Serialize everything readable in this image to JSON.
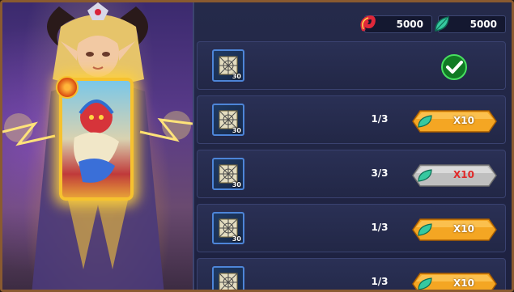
{
  "colors": {
    "row_bg": "#2a3055",
    "item_border": "#4d85d8",
    "button_gold": "#f4a623",
    "button_gray": "#bfbfbf",
    "disabled_text": "#e02a2a",
    "check_green": "#25c13c"
  },
  "hero": {
    "card_icon": "fire-element-icon"
  },
  "currency": [
    {
      "icon": "red-swirl-currency-icon",
      "value": "5000"
    },
    {
      "icon": "green-leaf-gem-icon",
      "value": "5000"
    }
  ],
  "rows": [
    {
      "item_icon": "web-scroll-icon",
      "qty": "30",
      "progress": "",
      "button_label": "",
      "status": "claimed"
    },
    {
      "item_icon": "web-scroll-icon",
      "qty": "30",
      "progress": "1/3",
      "button_label": "X10",
      "status": "available"
    },
    {
      "item_icon": "web-scroll-icon",
      "qty": "30",
      "progress": "3/3",
      "button_label": "X10",
      "status": "maxed"
    },
    {
      "item_icon": "web-scroll-icon",
      "qty": "30",
      "progress": "1/3",
      "button_label": "X10",
      "status": "available"
    },
    {
      "item_icon": "web-scroll-icon",
      "qty": "30",
      "progress": "1/3",
      "button_label": "X10",
      "status": "available"
    }
  ]
}
